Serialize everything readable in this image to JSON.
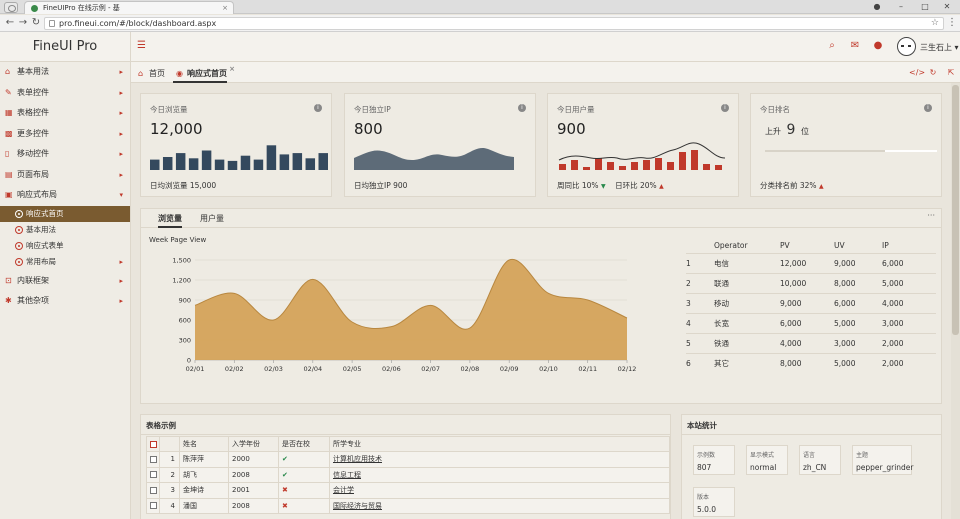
{
  "browser": {
    "tab_title": "FineUIPro 在线示例 - 基",
    "url": "pro.fineui.com/#/block/dashboard.aspx"
  },
  "header": {
    "brand": "FineUI Pro",
    "user_name": "三生石上"
  },
  "sidebar": {
    "items": [
      {
        "label": "基本用法",
        "icon": "home-icon"
      },
      {
        "label": "表单控件",
        "icon": "edit-icon"
      },
      {
        "label": "表格控件",
        "icon": "table-icon"
      },
      {
        "label": "更多控件",
        "icon": "grid-icon"
      },
      {
        "label": "移动控件",
        "icon": "mobile-icon"
      },
      {
        "label": "页面布局",
        "icon": "layout-icon"
      },
      {
        "label": "响应式布局",
        "icon": "responsive-icon"
      }
    ],
    "subitems": [
      {
        "label": "响应式首页"
      },
      {
        "label": "基本用法"
      },
      {
        "label": "响应式表单"
      },
      {
        "label": "常用布局"
      }
    ],
    "after": [
      {
        "label": "内联框架",
        "icon": "frame-icon"
      },
      {
        "label": "其他杂项",
        "icon": "misc-icon"
      }
    ]
  },
  "page_tabs": {
    "home": "首页",
    "current": "响应式首页",
    "close": "×"
  },
  "stats": {
    "views": {
      "title": "今日浏览量",
      "value": "12,000",
      "footer": "日均浏览量 15,000",
      "bars": [
        0.4,
        0.5,
        0.65,
        0.45,
        0.75,
        0.4,
        0.35,
        0.55,
        0.4,
        0.95,
        0.6,
        0.65,
        0.45,
        0.65
      ]
    },
    "unique_ip": {
      "title": "今日独立IP",
      "value": "800",
      "footer": "日均独立IP 900"
    },
    "users": {
      "title": "今日用户量",
      "value": "900",
      "footer_week": "周同比 10%",
      "footer_day": "日环比 20%"
    },
    "rank": {
      "title": "今日排名",
      "prefix": "上升",
      "value": "9",
      "suffix": "位",
      "footer": "分类排名前 32%",
      "percent": 0.7
    }
  },
  "chart_tabs": {
    "tab1": "浏览量",
    "tab2": "用户量",
    "more": "···"
  },
  "chart_data": {
    "type": "area",
    "title": "Week Page View",
    "x": [
      "02/01",
      "02/02",
      "02/03",
      "02/04",
      "02/05",
      "02/06",
      "02/07",
      "02/08",
      "02/09",
      "02/10",
      "02/11",
      "02/12"
    ],
    "values": [
      820,
      1000,
      600,
      1210,
      570,
      500,
      820,
      480,
      1500,
      1000,
      900,
      630
    ],
    "ylim": [
      0,
      1500
    ],
    "yticks": [
      "0",
      "300",
      "600",
      "900",
      "1,200",
      "1,500"
    ],
    "color": "#d4a35a"
  },
  "operator_table": {
    "headers": [
      "Operator",
      "PV",
      "UV",
      "IP"
    ],
    "rows": [
      [
        "1",
        "电信",
        "12,000",
        "9,000",
        "6,000"
      ],
      [
        "2",
        "联通",
        "10,000",
        "8,000",
        "5,000"
      ],
      [
        "3",
        "移动",
        "9,000",
        "6,000",
        "4,000"
      ],
      [
        "4",
        "长宽",
        "6,000",
        "5,000",
        "3,000"
      ],
      [
        "5",
        "铁通",
        "4,000",
        "3,000",
        "2,000"
      ],
      [
        "6",
        "其它",
        "8,000",
        "5,000",
        "2,000"
      ]
    ]
  },
  "grid": {
    "title": "表格示例",
    "headers": [
      "姓名",
      "入学年份",
      "是否在校",
      "所学专业"
    ],
    "rows": [
      {
        "no": "1",
        "name": "陈萍萍",
        "year": "2000",
        "in_school": true,
        "major": "计算机应用技术"
      },
      {
        "no": "2",
        "name": "胡飞",
        "year": "2008",
        "in_school": true,
        "major": "信息工程"
      },
      {
        "no": "3",
        "name": "金坤诗",
        "year": "2001",
        "in_school": false,
        "major": "会计学"
      },
      {
        "no": "4",
        "name": "潘国",
        "year": "2008",
        "in_school": false,
        "major": "国际经济与贸易"
      }
    ]
  },
  "site_stats": {
    "title": "本站统计",
    "boxes": [
      {
        "k": "示例数",
        "v": "807"
      },
      {
        "k": "显示模式",
        "v": "normal"
      },
      {
        "k": "语言",
        "v": "zh_CN"
      },
      {
        "k": "主题",
        "v": "pepper_grinder"
      },
      {
        "k": "版本",
        "v": "5.0.0"
      }
    ]
  }
}
